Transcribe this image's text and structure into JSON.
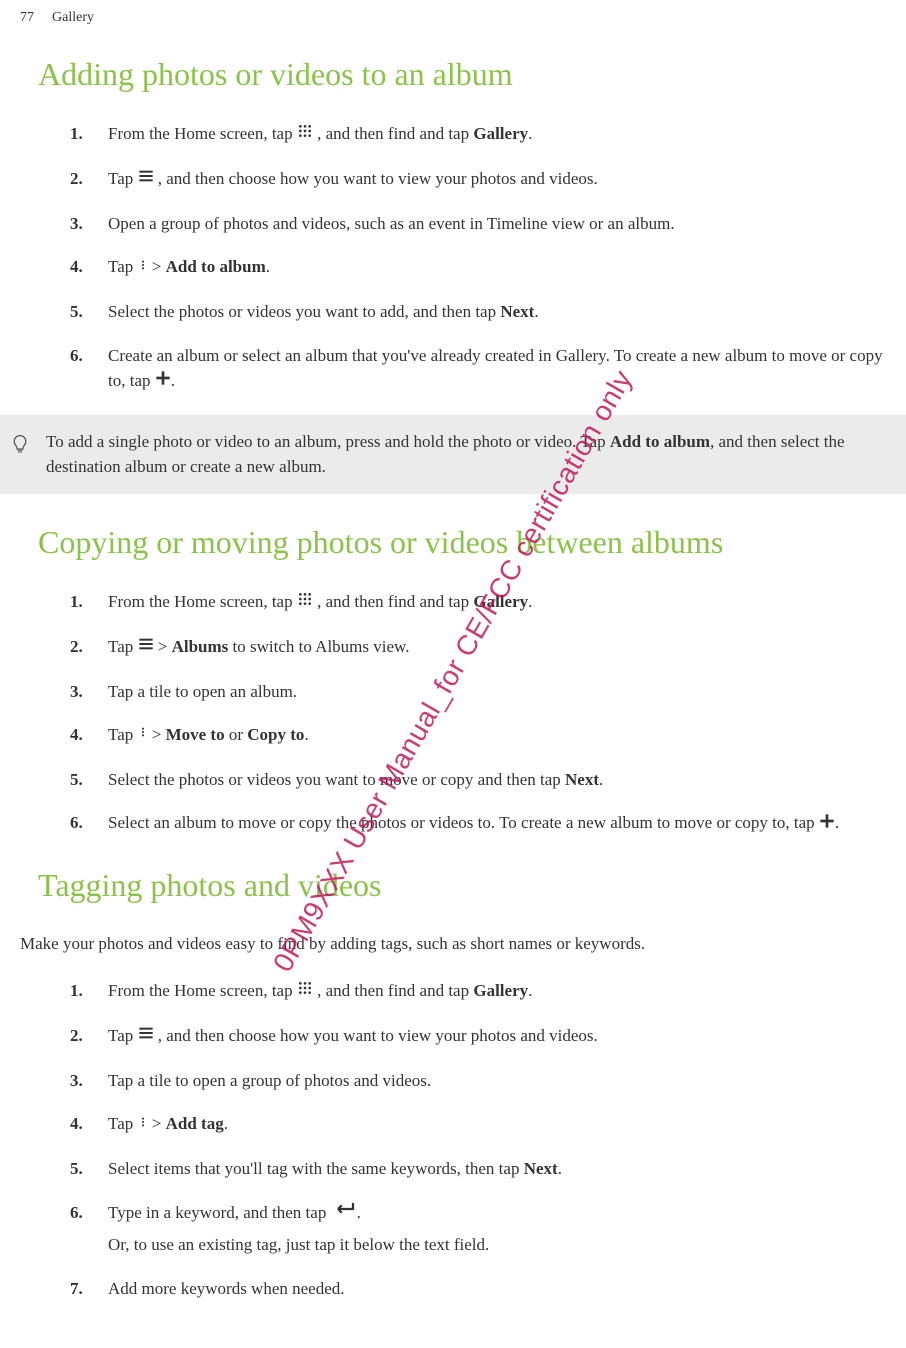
{
  "header": {
    "page_num": "77",
    "section": "Gallery"
  },
  "watermark": "0PM9XXX User Manual_for CE/FCC certification only",
  "sections": [
    {
      "heading": "Adding photos or videos to an album",
      "intro": "",
      "steps": [
        {
          "pre": "From the Home screen, tap ",
          "icon": "apps",
          "post": " , and then find and tap ",
          "bold1": "Gallery",
          "after1": "."
        },
        {
          "pre": "Tap ",
          "icon": "menu",
          "post": " , and then choose how you want to view your photos and videos."
        },
        {
          "pre": "Open a group of photos and videos, such as an event in Timeline view or an album."
        },
        {
          "pre": "Tap ",
          "icon": "more",
          "post": " > ",
          "bold1": "Add to album",
          "after1": "."
        },
        {
          "pre": "Select the photos or videos you want to add, and then tap ",
          "bold1": "Next",
          "after1": "."
        },
        {
          "pre": "Create an album or select an album that you've already created in Gallery. To create a new album to move or copy to, tap ",
          "icon": "plus",
          "post": "."
        }
      ],
      "tip": {
        "pre": "To add a single photo or video to an album, press and hold the photo or video. Tap ",
        "bold1": "Add to album",
        "after1": ", and then select the destination album or create a new album."
      }
    },
    {
      "heading": "Copying or moving photos or videos between albums",
      "intro": "",
      "steps": [
        {
          "pre": "From the Home screen, tap ",
          "icon": "apps",
          "post": " , and then find and tap ",
          "bold1": "Gallery",
          "after1": "."
        },
        {
          "pre": "Tap ",
          "icon": "menu",
          "post": "  > ",
          "bold1": "Albums",
          "after1": " to switch to Albums view."
        },
        {
          "pre": "Tap a tile to open an album."
        },
        {
          "pre": "Tap ",
          "icon": "more",
          "post": " > ",
          "bold1": "Move to",
          "after1": " or ",
          "bold2": "Copy to",
          "after2": "."
        },
        {
          "pre": "Select the photos or videos you want to move or copy and then tap ",
          "bold1": "Next",
          "after1": "."
        },
        {
          "pre": "Select an album to move or copy the photos or videos to. To create a new album to move or copy to, tap ",
          "icon": "plus",
          "post": "."
        }
      ]
    },
    {
      "heading": "Tagging photos and videos",
      "intro": "Make your photos and videos easy to find by adding tags, such as short names or keywords.",
      "steps": [
        {
          "pre": "From the Home screen, tap ",
          "icon": "apps",
          "post": " , and then find and tap ",
          "bold1": "Gallery",
          "after1": "."
        },
        {
          "pre": "Tap ",
          "icon": "menu",
          "post": " , and then choose how you want to view your photos and videos."
        },
        {
          "pre": "Tap a tile to open a group of photos and videos."
        },
        {
          "pre": "Tap ",
          "icon": "more",
          "post": " > ",
          "bold1": "Add tag",
          "after1": "."
        },
        {
          "pre": "Select items that you'll tag with the same keywords, then tap ",
          "bold1": "Next",
          "after1": "."
        },
        {
          "pre": "Type in a keyword, and then tap ",
          "icon": "enter",
          "post": ".",
          "sub": "Or, to use an existing tag, just tap it below the text field."
        },
        {
          "pre": "Add more keywords when needed."
        }
      ]
    }
  ]
}
